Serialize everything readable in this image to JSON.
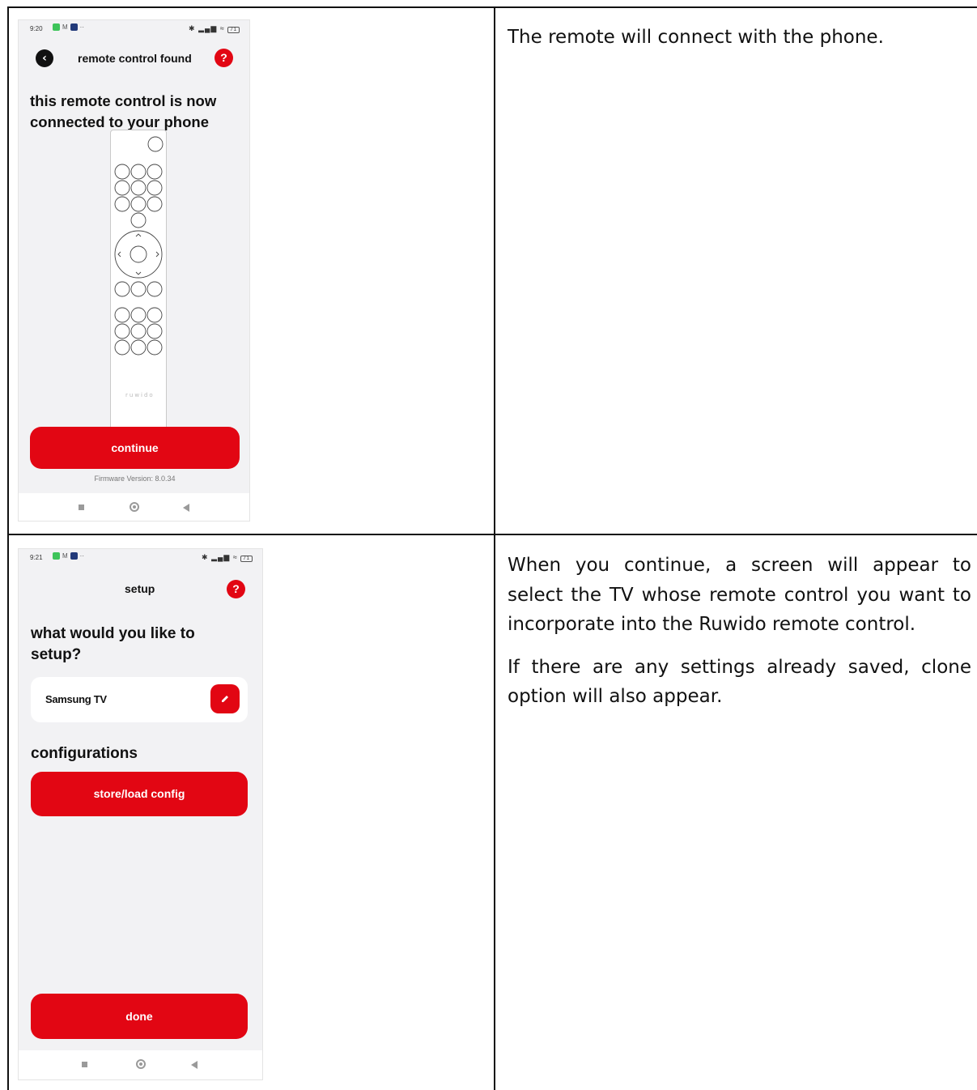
{
  "row1": {
    "screen": {
      "status_time": "9:20",
      "header_title": "remote control found",
      "heading": "this remote control is now connected to your phone",
      "remote_logo": "ruwido",
      "continue_label": "continue",
      "firmware": "Firmware Version: 8.0.34",
      "battery": "71"
    },
    "description": [
      "The remote will connect with the phone."
    ]
  },
  "row2": {
    "screen": {
      "status_time": "9:21",
      "header_title": "setup",
      "heading": "what would you like to setup?",
      "device_name": "Samsung TV",
      "configurations_heading": "configurations",
      "store_load_label": "store/load config",
      "done_label": "done",
      "battery": "71"
    },
    "description": [
      "When you continue, a screen will appear to select the TV whose remote control you want to incorporate into the Ruwido remote control.",
      "If there are any settings already saved, clone option will also appear."
    ]
  },
  "colors": {
    "accent": "#e20613",
    "screen_bg": "#f2f2f4"
  },
  "icons": [
    "back-arrow-icon",
    "help-icon",
    "edit-pencil-icon",
    "nav-square-icon",
    "nav-home-icon",
    "nav-back-icon",
    "wifi-icon",
    "battery-icon",
    "bluetooth-icon"
  ]
}
